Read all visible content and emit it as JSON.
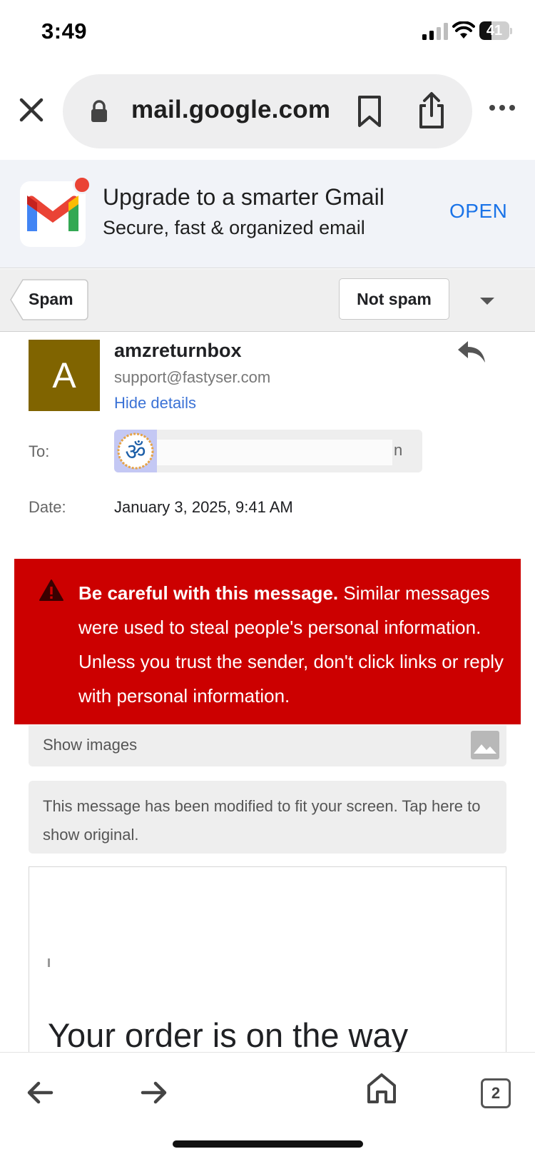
{
  "status_bar": {
    "time": "3:49",
    "battery_level": "41",
    "battery_fraction": 0.41
  },
  "browser": {
    "url": "mail.google.com",
    "open_tabs": "2",
    "icons": [
      "close-icon",
      "lock-icon",
      "bookmark-icon",
      "share-icon",
      "more-icon",
      "back-icon",
      "forward-icon",
      "home-icon",
      "tabs-icon"
    ]
  },
  "promo": {
    "title": "Upgrade to a smarter Gmail",
    "subtitle": "Secure, fast & organized email",
    "open_label": "OPEN"
  },
  "toolbar": {
    "spam_label": "Spam",
    "not_spam_label": "Not spam"
  },
  "email": {
    "avatar_letter": "A",
    "avatar_color": "#806400",
    "sender_name": "amzreturnbox",
    "sender_email": "support@fastyser.com",
    "hide_details": "Hide details",
    "to_label": "To:",
    "recipient_tail": "n",
    "recipient_avatar_symbol": "ॐ",
    "date_label": "Date:",
    "date_value": "January 3, 2025, 9:41 AM"
  },
  "warning": {
    "bold": "Be careful with this message.",
    "text": " Similar messages were used to steal people's personal information. Unless you trust the sender, don't click links or reply with personal information.",
    "color": "#cc0000"
  },
  "notices": {
    "show_images": "Show images",
    "modified": "This message has been modified to fit your screen. Tap here to show original."
  },
  "body": {
    "heading": "Your order is on the way"
  },
  "colors": {
    "link_blue": "#1a73e8",
    "warning_red": "#cc0000"
  }
}
